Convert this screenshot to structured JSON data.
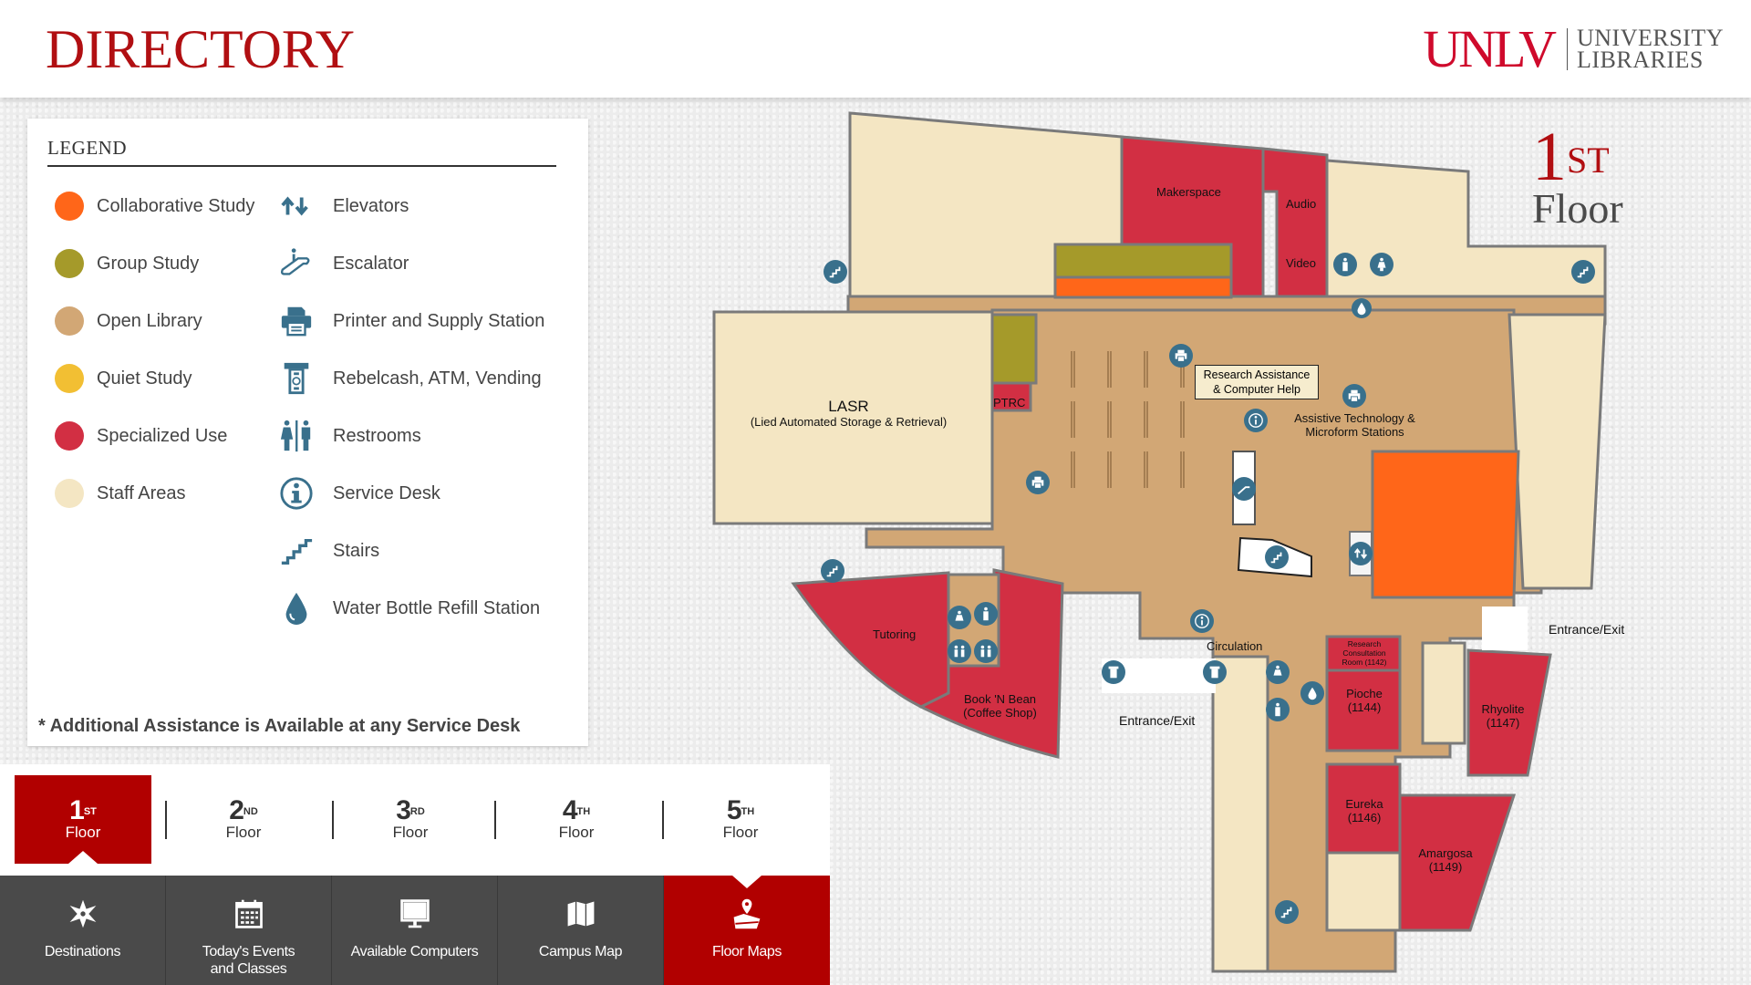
{
  "header": {
    "title": "DIRECTORY",
    "logo_primary": "UNLV",
    "logo_secondary_line1": "UNIVERSITY",
    "logo_secondary_line2": "LIBRARIES"
  },
  "legend": {
    "title": "LEGEND",
    "areas": [
      {
        "label": "Collaborative Study",
        "color": "#ff6619"
      },
      {
        "label": "Group Study",
        "color": "#a59a2a"
      },
      {
        "label": "Open Library",
        "color": "#d2a775"
      },
      {
        "label": "Quiet Study",
        "color": "#f2bf33"
      },
      {
        "label": "Specialized Use",
        "color": "#d22f43"
      },
      {
        "label": "Staff Areas",
        "color": "#f4e6c3"
      }
    ],
    "amenities": [
      {
        "label": "Elevators",
        "icon": "elevator-icon"
      },
      {
        "label": "Escalator",
        "icon": "escalator-icon"
      },
      {
        "label": "Printer and Supply Station",
        "icon": "printer-icon"
      },
      {
        "label": "Rebelcash, ATM, Vending",
        "icon": "atm-icon"
      },
      {
        "label": "Restrooms",
        "icon": "restroom-icon"
      },
      {
        "label": "Service Desk",
        "icon": "info-icon"
      },
      {
        "label": "Stairs",
        "icon": "stairs-icon"
      },
      {
        "label": "Water Bottle Refill Station",
        "icon": "water-drop-icon"
      }
    ],
    "note": "* Additional Assistance is Available at any Service Desk",
    "icon_color": "#39708c"
  },
  "floors": {
    "selected": 1,
    "tabs": [
      {
        "num": "1",
        "suffix": "ST",
        "word": "Floor"
      },
      {
        "num": "2",
        "suffix": "ND",
        "word": "Floor"
      },
      {
        "num": "3",
        "suffix": "RD",
        "word": "Floor"
      },
      {
        "num": "4",
        "suffix": "TH",
        "word": "Floor"
      },
      {
        "num": "5",
        "suffix": "TH",
        "word": "Floor"
      }
    ]
  },
  "nav": {
    "selected": "Floor Maps",
    "items": [
      {
        "label": "Destinations",
        "icon": "compass-star-icon"
      },
      {
        "label": "Today's Events and Classes",
        "icon": "calendar-icon"
      },
      {
        "label": "Available Computers",
        "icon": "monitor-icon"
      },
      {
        "label": "Campus Map",
        "icon": "folded-map-icon"
      },
      {
        "label": "Floor Maps",
        "icon": "map-pin-icon"
      }
    ]
  },
  "map": {
    "floor_indicator_num": "1",
    "floor_indicator_suffix": "ST",
    "floor_indicator_word": "Floor",
    "labels": {
      "makerspace": "Makerspace",
      "audio": "Audio",
      "video": "Video",
      "lasr": "LASR",
      "lasr_sub": "(Lied Automated Storage & Retrieval)",
      "ptrc": "PTRC",
      "research_line1": "Research Assistance",
      "research_line2": "& Computer Help",
      "assistive_line1": "Assistive Technology &",
      "assistive_line2": "Microform Stations",
      "tutoring": "Tutoring",
      "book_bean_line1": "Book 'N Bean",
      "book_bean_line2": "(Coffee Shop)",
      "circulation": "Circulation",
      "entrance_south": "Entrance/Exit",
      "entrance_east": "Entrance/Exit",
      "research_consult_line1": "Research",
      "research_consult_line2": "Consultation",
      "research_consult_line3": "Room (1142)",
      "pioche_line1": "Pioche",
      "pioche_line2": "(1144)",
      "eureka_line1": "Eureka",
      "eureka_line2": "(1146)",
      "rhyolite_line1": "Rhyolite",
      "rhyolite_line2": "(1147)",
      "amargosa_line1": "Amargosa",
      "amargosa_line2": "(1149)"
    }
  }
}
